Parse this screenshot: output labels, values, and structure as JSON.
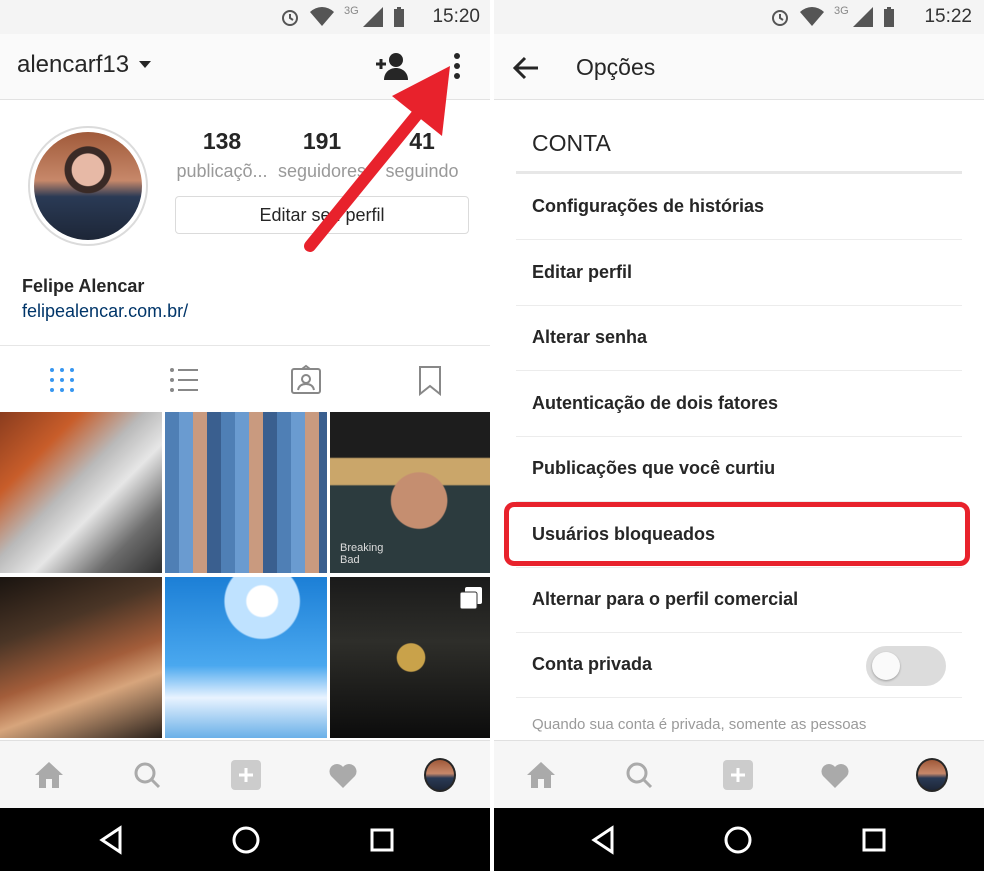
{
  "left": {
    "status": {
      "time": "15:20",
      "network": "3G"
    },
    "header": {
      "username": "alencarf13"
    },
    "profile": {
      "stats": [
        {
          "num": "138",
          "label": "publicaçõ..."
        },
        {
          "num": "191",
          "label": "seguidores"
        },
        {
          "num": "41",
          "label": "seguindo"
        }
      ],
      "edit_label": "Editar seu perfil",
      "full_name": "Felipe Alencar",
      "website": "felipealencar.com.br/"
    },
    "grid_overlay_text": "Breaking Bad"
  },
  "right": {
    "status": {
      "time": "15:22",
      "network": "3G"
    },
    "header": {
      "title": "Opções"
    },
    "section": "CONTA",
    "items": [
      {
        "label": "Configurações de histórias"
      },
      {
        "label": "Editar perfil"
      },
      {
        "label": "Alterar senha"
      },
      {
        "label": "Autenticação de dois fatores"
      },
      {
        "label": "Publicações que você curtiu"
      },
      {
        "label": "Usuários bloqueados"
      },
      {
        "label": "Alternar para o perfil comercial"
      },
      {
        "label": "Conta privada"
      }
    ],
    "private_note": "Quando sua conta é privada, somente as pessoas",
    "private_toggle_on": false
  },
  "colors": {
    "highlight": "#e8222c",
    "arrow": "#e8222c",
    "link": "#003569"
  }
}
